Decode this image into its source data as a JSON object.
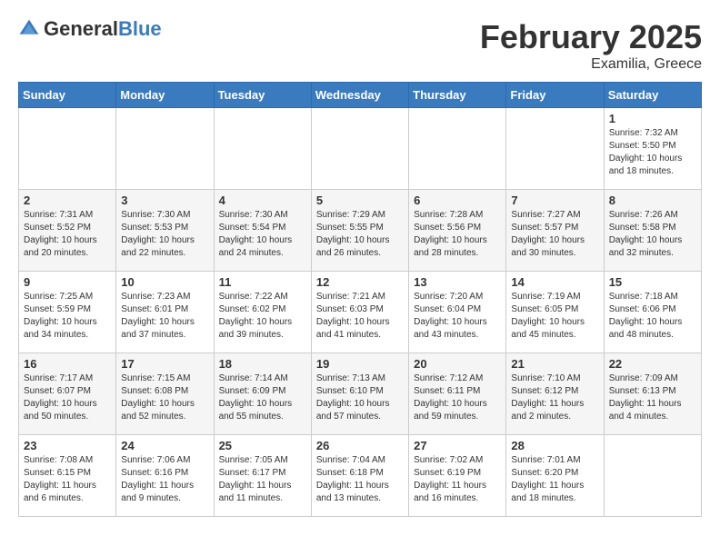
{
  "header": {
    "logo_general": "General",
    "logo_blue": "Blue",
    "title": "February 2025",
    "subtitle": "Examilia, Greece"
  },
  "days_of_week": [
    "Sunday",
    "Monday",
    "Tuesday",
    "Wednesday",
    "Thursday",
    "Friday",
    "Saturday"
  ],
  "weeks": [
    [
      {
        "day": "",
        "info": ""
      },
      {
        "day": "",
        "info": ""
      },
      {
        "day": "",
        "info": ""
      },
      {
        "day": "",
        "info": ""
      },
      {
        "day": "",
        "info": ""
      },
      {
        "day": "",
        "info": ""
      },
      {
        "day": "1",
        "info": "Sunrise: 7:32 AM\nSunset: 5:50 PM\nDaylight: 10 hours and 18 minutes."
      }
    ],
    [
      {
        "day": "2",
        "info": "Sunrise: 7:31 AM\nSunset: 5:52 PM\nDaylight: 10 hours and 20 minutes."
      },
      {
        "day": "3",
        "info": "Sunrise: 7:30 AM\nSunset: 5:53 PM\nDaylight: 10 hours and 22 minutes."
      },
      {
        "day": "4",
        "info": "Sunrise: 7:30 AM\nSunset: 5:54 PM\nDaylight: 10 hours and 24 minutes."
      },
      {
        "day": "5",
        "info": "Sunrise: 7:29 AM\nSunset: 5:55 PM\nDaylight: 10 hours and 26 minutes."
      },
      {
        "day": "6",
        "info": "Sunrise: 7:28 AM\nSunset: 5:56 PM\nDaylight: 10 hours and 28 minutes."
      },
      {
        "day": "7",
        "info": "Sunrise: 7:27 AM\nSunset: 5:57 PM\nDaylight: 10 hours and 30 minutes."
      },
      {
        "day": "8",
        "info": "Sunrise: 7:26 AM\nSunset: 5:58 PM\nDaylight: 10 hours and 32 minutes."
      }
    ],
    [
      {
        "day": "9",
        "info": "Sunrise: 7:25 AM\nSunset: 5:59 PM\nDaylight: 10 hours and 34 minutes."
      },
      {
        "day": "10",
        "info": "Sunrise: 7:23 AM\nSunset: 6:01 PM\nDaylight: 10 hours and 37 minutes."
      },
      {
        "day": "11",
        "info": "Sunrise: 7:22 AM\nSunset: 6:02 PM\nDaylight: 10 hours and 39 minutes."
      },
      {
        "day": "12",
        "info": "Sunrise: 7:21 AM\nSunset: 6:03 PM\nDaylight: 10 hours and 41 minutes."
      },
      {
        "day": "13",
        "info": "Sunrise: 7:20 AM\nSunset: 6:04 PM\nDaylight: 10 hours and 43 minutes."
      },
      {
        "day": "14",
        "info": "Sunrise: 7:19 AM\nSunset: 6:05 PM\nDaylight: 10 hours and 45 minutes."
      },
      {
        "day": "15",
        "info": "Sunrise: 7:18 AM\nSunset: 6:06 PM\nDaylight: 10 hours and 48 minutes."
      }
    ],
    [
      {
        "day": "16",
        "info": "Sunrise: 7:17 AM\nSunset: 6:07 PM\nDaylight: 10 hours and 50 minutes."
      },
      {
        "day": "17",
        "info": "Sunrise: 7:15 AM\nSunset: 6:08 PM\nDaylight: 10 hours and 52 minutes."
      },
      {
        "day": "18",
        "info": "Sunrise: 7:14 AM\nSunset: 6:09 PM\nDaylight: 10 hours and 55 minutes."
      },
      {
        "day": "19",
        "info": "Sunrise: 7:13 AM\nSunset: 6:10 PM\nDaylight: 10 hours and 57 minutes."
      },
      {
        "day": "20",
        "info": "Sunrise: 7:12 AM\nSunset: 6:11 PM\nDaylight: 10 hours and 59 minutes."
      },
      {
        "day": "21",
        "info": "Sunrise: 7:10 AM\nSunset: 6:12 PM\nDaylight: 11 hours and 2 minutes."
      },
      {
        "day": "22",
        "info": "Sunrise: 7:09 AM\nSunset: 6:13 PM\nDaylight: 11 hours and 4 minutes."
      }
    ],
    [
      {
        "day": "23",
        "info": "Sunrise: 7:08 AM\nSunset: 6:15 PM\nDaylight: 11 hours and 6 minutes."
      },
      {
        "day": "24",
        "info": "Sunrise: 7:06 AM\nSunset: 6:16 PM\nDaylight: 11 hours and 9 minutes."
      },
      {
        "day": "25",
        "info": "Sunrise: 7:05 AM\nSunset: 6:17 PM\nDaylight: 11 hours and 11 minutes."
      },
      {
        "day": "26",
        "info": "Sunrise: 7:04 AM\nSunset: 6:18 PM\nDaylight: 11 hours and 13 minutes."
      },
      {
        "day": "27",
        "info": "Sunrise: 7:02 AM\nSunset: 6:19 PM\nDaylight: 11 hours and 16 minutes."
      },
      {
        "day": "28",
        "info": "Sunrise: 7:01 AM\nSunset: 6:20 PM\nDaylight: 11 hours and 18 minutes."
      },
      {
        "day": "",
        "info": ""
      }
    ]
  ]
}
